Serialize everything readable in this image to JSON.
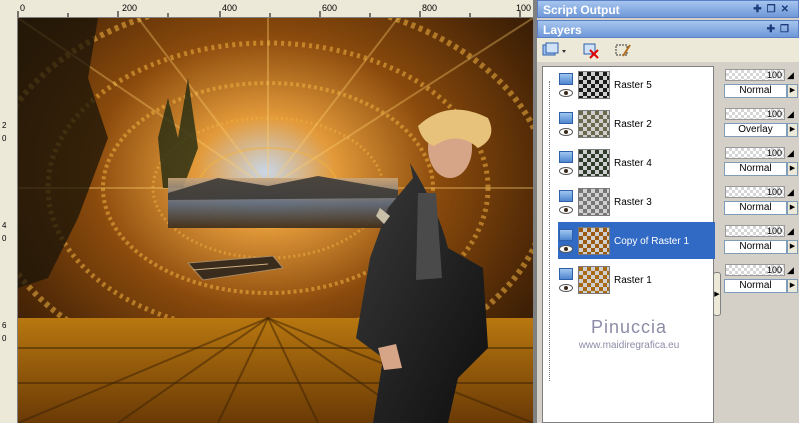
{
  "ruler": {
    "top_ticks": [
      "0",
      "200",
      "400",
      "600",
      "800",
      "100"
    ],
    "left_ticks": [
      "2",
      "0",
      "4",
      "0",
      "6",
      "0"
    ]
  },
  "palettes": {
    "script_output": {
      "title": "Script Output"
    },
    "layers": {
      "title": "Layers"
    }
  },
  "icons": {
    "new_layer": "new-raster-layer-icon",
    "delete_layer": "delete-layer-icon",
    "edit_selection": "edit-selection-icon",
    "pin": "pin-icon",
    "float": "float-icon"
  },
  "layers": [
    {
      "name": "Raster 5",
      "opacity": "100",
      "blend": "Normal",
      "selected": false,
      "thumb": "#1a1a1a"
    },
    {
      "name": "Raster 2",
      "opacity": "100",
      "blend": "Overlay",
      "selected": false,
      "thumb": "#6a6a4a"
    },
    {
      "name": "Raster 4",
      "opacity": "100",
      "blend": "Normal",
      "selected": false,
      "thumb": "#2e3a2a"
    },
    {
      "name": "Raster 3",
      "opacity": "100",
      "blend": "Normal",
      "selected": false,
      "thumb": "#777777"
    },
    {
      "name": "Copy of Raster 1",
      "opacity": "100",
      "blend": "Normal",
      "selected": true,
      "thumb": "#9a5a10"
    },
    {
      "name": "Raster 1",
      "opacity": "100",
      "blend": "Normal",
      "selected": false,
      "thumb": "#a86a14"
    }
  ],
  "watermark": {
    "line1": "Pinuccia",
    "line2": "www.maidiregrafica.eu"
  },
  "colors": {
    "selection": "#316ac5",
    "title_bar": "#6f98d8"
  }
}
